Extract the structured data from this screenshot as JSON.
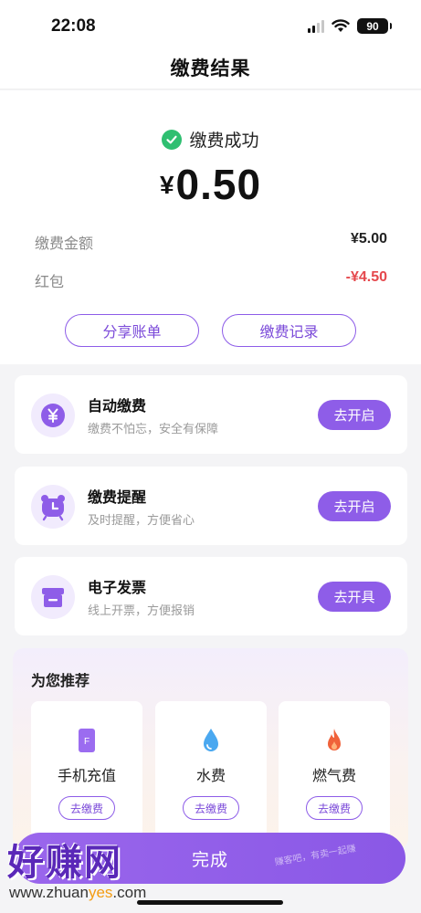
{
  "status_bar": {
    "time": "22:08",
    "battery": "90"
  },
  "nav": {
    "title": "缴费结果"
  },
  "result": {
    "status_text": "缴费成功",
    "currency": "¥",
    "amount": "0.50",
    "details": [
      {
        "label": "缴费金额",
        "value": "¥5.00"
      },
      {
        "label": "红包",
        "value": "-¥4.50"
      }
    ],
    "share_label": "分享账单",
    "records_label": "缴费记录"
  },
  "services": [
    {
      "title": "自动缴费",
      "subtitle": "缴费不怕忘，安全有保障",
      "button": "去开启",
      "icon": "yen-icon"
    },
    {
      "title": "缴费提醒",
      "subtitle": "及时提醒，方便省心",
      "button": "去开启",
      "icon": "alarm-clock-icon"
    },
    {
      "title": "电子发票",
      "subtitle": "线上开票，方便报销",
      "button": "去开具",
      "icon": "printer-icon"
    }
  ],
  "recommend": {
    "title": "为您推荐",
    "items": [
      {
        "label": "手机充值",
        "button": "去缴费",
        "icon": "phone-card-icon"
      },
      {
        "label": "水费",
        "button": "去缴费",
        "icon": "water-drop-icon"
      },
      {
        "label": "燃气费",
        "button": "去缴费",
        "icon": "flame-icon"
      }
    ]
  },
  "done_label": "完成",
  "watermark": {
    "logo_text": "好赚网",
    "url_prefix": "www.zhuan",
    "url_highlight": "yes",
    "url_suffix": ".com",
    "faint_text": "赚客吧，有卖一起赚"
  },
  "colors": {
    "accent": "#8e5de8",
    "success": "#2fbf71",
    "negative": "#e5484d"
  }
}
